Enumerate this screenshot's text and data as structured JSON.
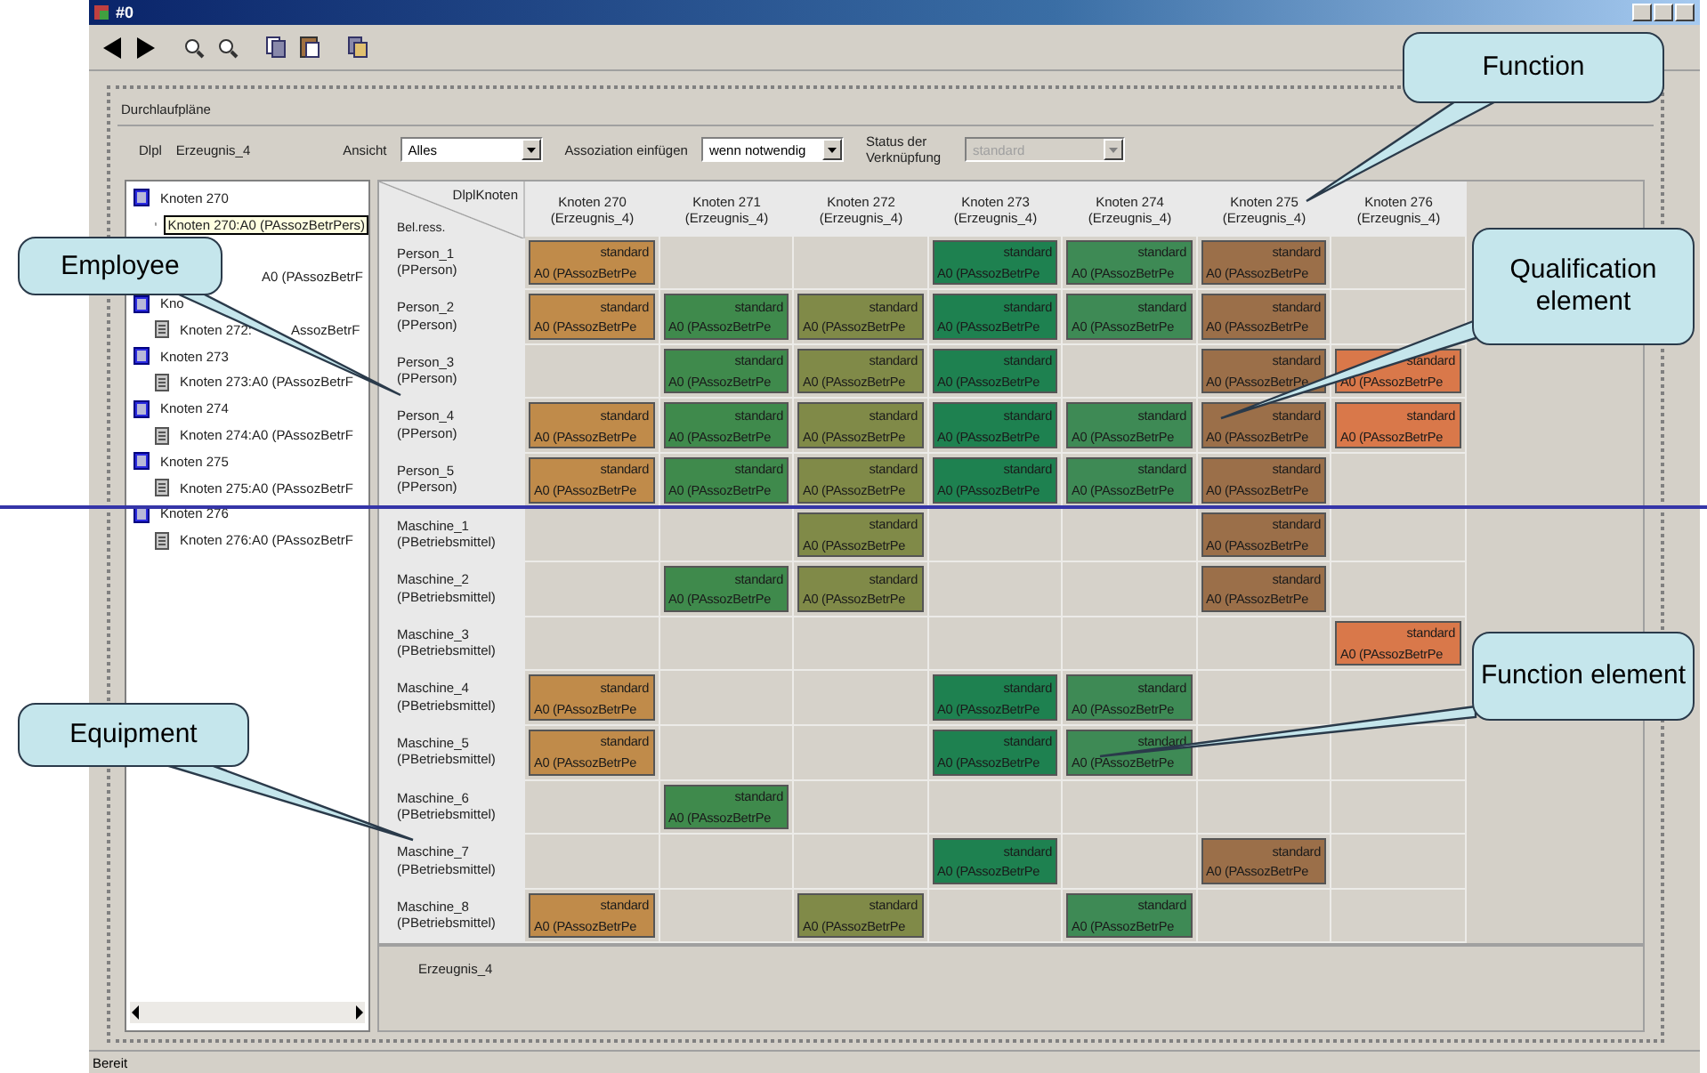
{
  "window": {
    "title": "#0"
  },
  "panel_title": "Durchlaufpläne",
  "filters": {
    "label": "Dlpl",
    "value": "Erzeugnis_4",
    "fields": [
      {
        "label": "Ansicht",
        "value": "Alles",
        "disabled": false
      },
      {
        "label": "Assoziation einfügen",
        "value": "wenn notwendig",
        "disabled": false
      },
      {
        "label": "Status der Verknüpfung",
        "value": "standard",
        "disabled": true
      }
    ]
  },
  "tree": [
    {
      "label": "Knoten 270",
      "children": [
        {
          "label": "Knoten 270:A0 (PAssozBetrPers)",
          "selected": true
        }
      ]
    },
    {
      "children": [
        {
          "label": "A0 (PAssozBetrF",
          "selected": false,
          "kind": "clipped"
        }
      ]
    },
    {
      "label": "Kno",
      "children": [
        {
          "label": "Knoten 272:",
          "selected": false
        },
        {
          "label": "AssozBetrF",
          "selected": false,
          "kind": "clipped"
        }
      ]
    },
    {
      "label": "Knoten 273",
      "children": [
        {
          "label": "Knoten 273:A0 (PAssozBetrF",
          "selected": false
        }
      ]
    },
    {
      "label": "Knoten 274",
      "children": [
        {
          "label": "Knoten 274:A0 (PAssozBetrF",
          "selected": false
        }
      ]
    },
    {
      "label": "Knoten 275",
      "children": [
        {
          "label": "Knoten 275:A0 (PAssozBetrF",
          "selected": false
        }
      ]
    },
    {
      "label": "Knoten 276",
      "children": [
        {
          "label": "Knoten 276:A0 (PAssozBetrF",
          "selected": false
        }
      ]
    }
  ],
  "grid": {
    "corner_top": "DlplKnoten",
    "corner_bottom": "Bel.ress.",
    "columns": [
      {
        "name": "Knoten 270",
        "sub": "(Erzeugnis_4)",
        "color": "#c08b4a"
      },
      {
        "name": "Knoten 271",
        "sub": "(Erzeugnis_4)",
        "color": "#3f8a4c"
      },
      {
        "name": "Knoten 272",
        "sub": "(Erzeugnis_4)",
        "color": "#808a48"
      },
      {
        "name": "Knoten 273",
        "sub": "(Erzeugnis_4)",
        "color": "#1e8150"
      },
      {
        "name": "Knoten 274",
        "sub": "(Erzeugnis_4)",
        "color": "#3e8a55"
      },
      {
        "name": "Knoten 275",
        "sub": "(Erzeugnis_4)",
        "color": "#9b6f49"
      },
      {
        "name": "Knoten 276",
        "sub": "(Erzeugnis_4)",
        "color": "#d9784a"
      }
    ],
    "rows": [
      {
        "name": "Person_1",
        "sub": "(PPerson)",
        "cells": [
          {
            "status": "standard",
            "label": "A0 (PAssozBetrPe"
          },
          null,
          null,
          {
            "status": "standard",
            "label": "A0 (PAssozBetrPe"
          },
          {
            "status": "standard",
            "label": "A0 (PAssozBetrPe"
          },
          {
            "status": "standard",
            "label": "A0 (PAssozBetrPe"
          },
          null
        ]
      },
      {
        "name": "Person_2",
        "sub": "(PPerson)",
        "cells": [
          {
            "status": "standard",
            "label": "A0 (PAssozBetrPe"
          },
          {
            "status": "standard",
            "label": "A0 (PAssozBetrPe"
          },
          {
            "status": "standard",
            "label": "A0 (PAssozBetrPe"
          },
          {
            "status": "standard",
            "label": "A0 (PAssozBetrPe"
          },
          {
            "status": "standard",
            "label": "A0 (PAssozBetrPe"
          },
          {
            "status": "standard",
            "label": "A0 (PAssozBetrPe"
          },
          null
        ]
      },
      {
        "name": "Person_3",
        "sub": "(PPerson)",
        "cells": [
          null,
          {
            "status": "standard",
            "label": "A0 (PAssozBetrPe"
          },
          {
            "status": "standard",
            "label": "A0 (PAssozBetrPe"
          },
          {
            "status": "standard",
            "label": "A0 (PAssozBetrPe"
          },
          null,
          {
            "status": "standard",
            "label": "A0 (PAssozBetrPe"
          },
          {
            "status": "standard",
            "label": "A0 (PAssozBetrPe"
          }
        ]
      },
      {
        "name": "Person_4",
        "sub": "(PPerson)",
        "cells": [
          {
            "status": "standard",
            "label": "A0 (PAssozBetrPe"
          },
          {
            "status": "standard",
            "label": "A0 (PAssozBetrPe"
          },
          {
            "status": "standard",
            "label": "A0 (PAssozBetrPe"
          },
          {
            "status": "standard",
            "label": "A0 (PAssozBetrPe"
          },
          {
            "status": "standard",
            "label": "A0 (PAssozBetrPe"
          },
          {
            "status": "standard",
            "label": "A0 (PAssozBetrPe"
          },
          {
            "status": "standard",
            "label": "A0 (PAssozBetrPe"
          }
        ]
      },
      {
        "name": "Person_5",
        "sub": "(PPerson)",
        "cells": [
          {
            "status": "standard",
            "label": "A0 (PAssozBetrPe"
          },
          {
            "status": "standard",
            "label": "A0 (PAssozBetrPe"
          },
          {
            "status": "standard",
            "label": "A0 (PAssozBetrPe"
          },
          {
            "status": "standard",
            "label": "A0 (PAssozBetrPe"
          },
          {
            "status": "standard",
            "label": "A0 (PAssozBetrPe"
          },
          {
            "status": "standard",
            "label": "A0 (PAssozBetrPe"
          },
          null
        ]
      },
      {
        "name": "Maschine_1",
        "sub": "(PBetriebsmittel)",
        "cells": [
          null,
          null,
          {
            "status": "standard",
            "label": "A0 (PAssozBetrPe"
          },
          null,
          null,
          {
            "status": "standard",
            "label": "A0 (PAssozBetrPe"
          },
          null
        ]
      },
      {
        "name": "Maschine_2",
        "sub": "(PBetriebsmittel)",
        "cells": [
          null,
          {
            "status": "standard",
            "label": "A0 (PAssozBetrPe"
          },
          {
            "status": "standard",
            "label": "A0 (PAssozBetrPe"
          },
          null,
          null,
          {
            "status": "standard",
            "label": "A0 (PAssozBetrPe"
          },
          null
        ]
      },
      {
        "name": "Maschine_3",
        "sub": "(PBetriebsmittel)",
        "cells": [
          null,
          null,
          null,
          null,
          null,
          null,
          {
            "status": "standard",
            "label": "A0 (PAssozBetrPe"
          }
        ]
      },
      {
        "name": "Maschine_4",
        "sub": "(PBetriebsmittel)",
        "cells": [
          {
            "status": "standard",
            "label": "A0 (PAssozBetrPe"
          },
          null,
          null,
          {
            "status": "standard",
            "label": "A0 (PAssozBetrPe"
          },
          {
            "status": "standard",
            "label": "A0 (PAssozBetrPe"
          },
          null,
          null
        ]
      },
      {
        "name": "Maschine_5",
        "sub": "(PBetriebsmittel)",
        "cells": [
          {
            "status": "standard",
            "label": "A0 (PAssozBetrPe"
          },
          null,
          null,
          {
            "status": "standard",
            "label": "A0 (PAssozBetrPe"
          },
          {
            "status": "standard",
            "label": "A0 (PAssozBetrPe"
          },
          null,
          null
        ]
      },
      {
        "name": "Maschine_6",
        "sub": "(PBetriebsmittel)",
        "cells": [
          null,
          {
            "status": "standard",
            "label": "A0 (PAssozBetrPe"
          },
          null,
          null,
          null,
          null,
          null
        ]
      },
      {
        "name": "Maschine_7",
        "sub": "(PBetriebsmittel)",
        "cells": [
          null,
          null,
          null,
          {
            "status": "standard",
            "label": "A0 (PAssozBetrPe"
          },
          null,
          {
            "status": "standard",
            "label": "A0 (PAssozBetrPe"
          },
          null
        ]
      },
      {
        "name": "Maschine_8",
        "sub": "(PBetriebsmittel)",
        "cells": [
          {
            "status": "standard",
            "label": "A0 (PAssozBetrPe"
          },
          null,
          {
            "status": "standard",
            "label": "A0 (PAssozBetrPe"
          },
          null,
          {
            "status": "standard",
            "label": "A0 (PAssozBetrPe"
          },
          null,
          null
        ]
      }
    ],
    "footer": "Erzeugnis_4"
  },
  "status_bar": "Bereit",
  "callouts": [
    {
      "text": "Function"
    },
    {
      "text": "Employee"
    },
    {
      "text": "Qualification element"
    },
    {
      "text": "Equipment"
    },
    {
      "text": "Function element"
    }
  ]
}
